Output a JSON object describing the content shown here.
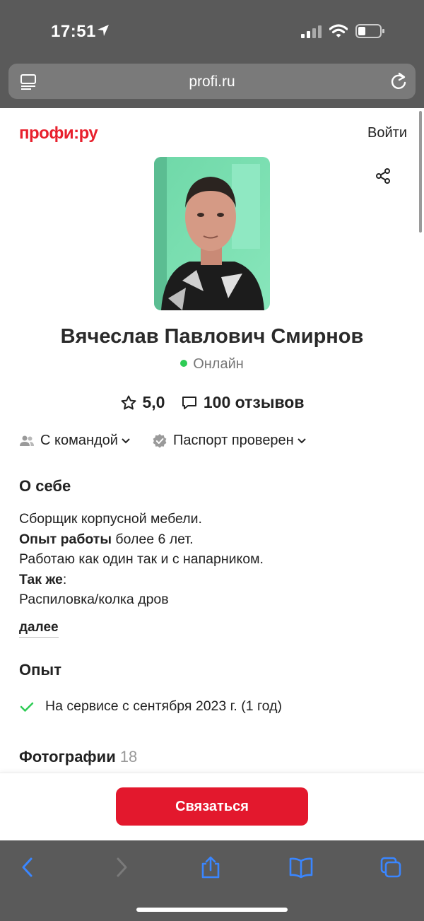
{
  "status_bar": {
    "time": "17:51"
  },
  "browser": {
    "url": "profi.ru"
  },
  "header": {
    "logo": "профи:ру",
    "login_label": "Войти"
  },
  "profile": {
    "name": "Вячеслав Павлович Смирнов",
    "status": "Онлайн",
    "rating": "5,0",
    "reviews": "100 отзывов",
    "badges": [
      "С командой",
      "Паспорт проверен"
    ]
  },
  "about": {
    "title": "О себе",
    "lines": [
      {
        "bold": "",
        "text": "Сборщик корпусной мебели."
      },
      {
        "bold": "Опыт работы",
        "text": " более 6 лет."
      },
      {
        "bold": "",
        "text": "Работаю как один так и с напарником."
      },
      {
        "bold": "Так же",
        "text": ":"
      },
      {
        "bold": "",
        "text": "Распиловка/колка дров"
      }
    ],
    "more_label": "далее"
  },
  "experience": {
    "title": "Опыт",
    "item": "На сервисе с сентября 2023 г. (1 год)"
  },
  "photos": {
    "title": "Фотографии",
    "count": "18"
  },
  "cta": {
    "label": "Связаться"
  },
  "colors": {
    "brand": "#e8202d",
    "button": "#e3182d",
    "online": "#2ecc55",
    "toolbar_icons": "#2f7bf5"
  },
  "icons": {
    "toolbar": [
      "back-icon",
      "forward-icon",
      "share-icon",
      "bookmarks-icon",
      "tabs-icon"
    ]
  }
}
